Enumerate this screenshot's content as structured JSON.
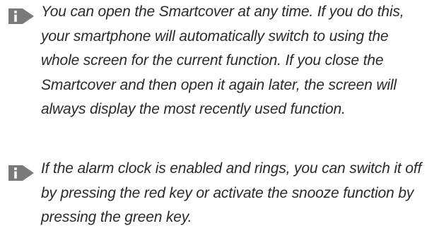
{
  "notes": [
    {
      "icon": "info-icon",
      "text": "You can open the Smartcover at any time. If you do this, your smartphone will automatically switch to using the whole screen for the current function. If you close the Smartcover and then open it again later, the screen will always display the most recently used function."
    },
    {
      "icon": "info-icon",
      "text": "If the alarm clock is enabled and rings, you can switch it off by pressing the red key or activate the snooze function by pressing the green key."
    }
  ],
  "colors": {
    "icon_fill": "#7a7a7a",
    "text": "#2a2a2a"
  }
}
